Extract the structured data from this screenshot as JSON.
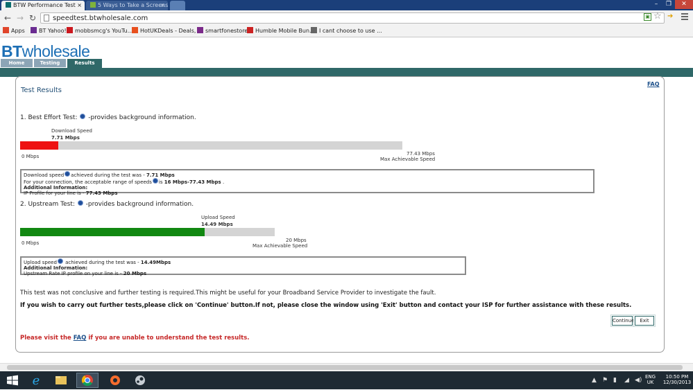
{
  "browser": {
    "tabs": [
      {
        "title": "BTW Performance Test",
        "active": true
      },
      {
        "title": "5 Ways to Take a Screens",
        "active": false
      },
      {
        "title": "",
        "active": false
      }
    ],
    "url": "speedtest.btwholesale.com",
    "bookmarks": [
      {
        "label": "Apps",
        "icon": "apps-grid-icon",
        "color": "#e0452b"
      },
      {
        "label": "BT Yahoo!",
        "icon": "bt-icon",
        "color": "#6a2c91"
      },
      {
        "label": "mobbsmcg's YouTu...",
        "icon": "youtube-icon",
        "color": "#cc181e"
      },
      {
        "label": "HotUKDeals - Deals, ...",
        "icon": "flame-icon",
        "color": "#e8501e"
      },
      {
        "label": "smartfonestore",
        "icon": "s-logo-icon",
        "color": "#7b2a8a"
      },
      {
        "label": "Humble Mobile Bun...",
        "icon": "humble-icon",
        "color": "#cc2222"
      },
      {
        "label": "I cant choose to use ...",
        "icon": "link-icon",
        "color": "#666666"
      }
    ]
  },
  "site": {
    "logo_bt": "BT",
    "logo_rest": "wholesale",
    "nav": [
      "Home",
      "Testing",
      "Results"
    ],
    "active_nav": "Results"
  },
  "results": {
    "faq_link": "FAQ",
    "title": "Test Results",
    "best_effort": {
      "heading_prefix": "1. Best Effort Test: ",
      "heading_suffix": " -provides background information.",
      "label": "Download Speed",
      "speed_text": "7.71 Mbps",
      "min_label": "0 Mbps",
      "max_value_text": "77.43 Mbps",
      "max_label": "Max Achievable Speed",
      "value": 7.71,
      "max": 77.43,
      "color": "#ee1111",
      "info_lines": [
        {
          "a": "Download speed",
          "icon": true,
          "b": "achieved during the test was - ",
          "bold": "7.71 Mbps",
          "c": ""
        },
        {
          "a": "For your connection, the acceptable range of speeds",
          "icon": true,
          "b": "is ",
          "bold": "16 Mbps-77.43 Mbps",
          "c": " ."
        },
        {
          "a": "",
          "icon": false,
          "b": "",
          "bold": "Additional Information:",
          "c": ""
        },
        {
          "a": "IP Profile for your line is - ",
          "icon": false,
          "b": "",
          "bold": "77.43 Mbps",
          "c": ""
        }
      ]
    },
    "upstream": {
      "heading_prefix": "2. Upstream Test: ",
      "heading_suffix": " -provides background information.",
      "label": "Upload Speed",
      "speed_text": "14.49 Mbps",
      "min_label": "0 Mbps",
      "max_value_text": "20 Mbps",
      "max_label": "Max Achievable Speed",
      "value": 14.49,
      "max": 20,
      "color": "#118811",
      "info_lines": [
        {
          "a": "Upload speed",
          "icon": true,
          "b": " achieved during the test was - ",
          "bold": "14.49Mbps",
          "c": ""
        },
        {
          "a": "",
          "icon": false,
          "b": "",
          "bold": "Additional Information:",
          "c": ""
        },
        {
          "a": "Upstream Rate IP profile on your line is - ",
          "icon": false,
          "b": "",
          "bold": "20 Mbps",
          "c": ""
        }
      ]
    },
    "note": "This test was not conclusive and further testing is required.This might be useful for your Broadband Service Provider to investigate the fault.",
    "instruction": "If you wish to carry out further tests,please click on 'Continue' button.If not, please close the window using 'Exit' button and contact your ISP for further assistance with these results.",
    "continue_label": "Continue",
    "exit_label": "Exit",
    "visit_prefix": "Please visit the ",
    "visit_link": "FAQ",
    "visit_suffix": " if you are unable to understand the test results."
  },
  "taskbar": {
    "apps": [
      "windows-start-icon",
      "internet-explorer-icon",
      "file-explorer-icon",
      "chrome-icon",
      "origin-icon",
      "steam-icon"
    ],
    "lang_top": "ENG",
    "lang_bottom": "UK",
    "time": "10:50 PM",
    "date": "12/30/2013"
  },
  "colors": {
    "brand_blue": "#1d6fb5",
    "teal": "#2f6868",
    "download_bar": "#ee1111",
    "upload_bar": "#118811",
    "alert_red": "#c62828"
  }
}
